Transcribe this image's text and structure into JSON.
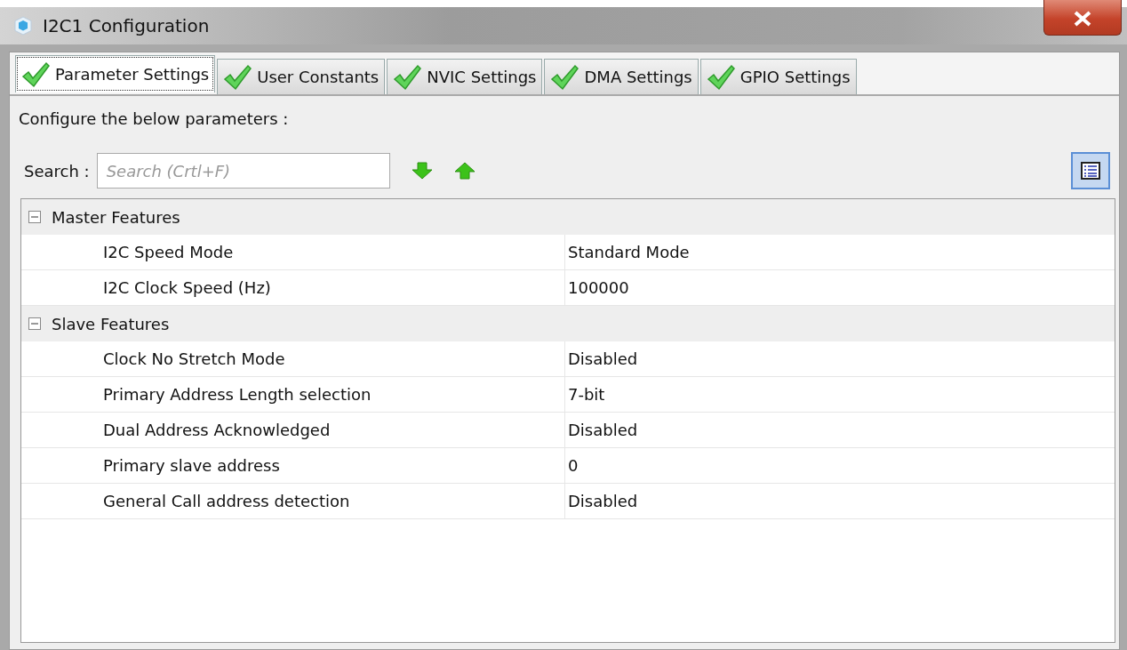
{
  "window": {
    "title": "I2C1 Configuration"
  },
  "tabs": [
    {
      "label": "Parameter Settings",
      "selected": true
    },
    {
      "label": "User Constants",
      "selected": false
    },
    {
      "label": "NVIC Settings",
      "selected": false
    },
    {
      "label": "DMA Settings",
      "selected": false
    },
    {
      "label": "GPIO Settings",
      "selected": false
    }
  ],
  "instructions": "Configure the below parameters :",
  "search": {
    "label": "Search :",
    "placeholder": "Search (Crtl+F)"
  },
  "groups": [
    {
      "name": "Master Features",
      "expanded": true,
      "rows": [
        {
          "parameter": "I2C Speed Mode",
          "value": "Standard Mode"
        },
        {
          "parameter": "I2C Clock Speed (Hz)",
          "value": "100000"
        }
      ]
    },
    {
      "name": "Slave Features",
      "expanded": true,
      "rows": [
        {
          "parameter": "Clock No Stretch Mode",
          "value": "Disabled"
        },
        {
          "parameter": "Primary Address Length selection",
          "value": "7-bit"
        },
        {
          "parameter": "Dual Address Acknowledged",
          "value": "Disabled"
        },
        {
          "parameter": "Primary slave address",
          "value": "0"
        },
        {
          "parameter": "General Call address detection",
          "value": "Disabled"
        }
      ]
    }
  ]
}
